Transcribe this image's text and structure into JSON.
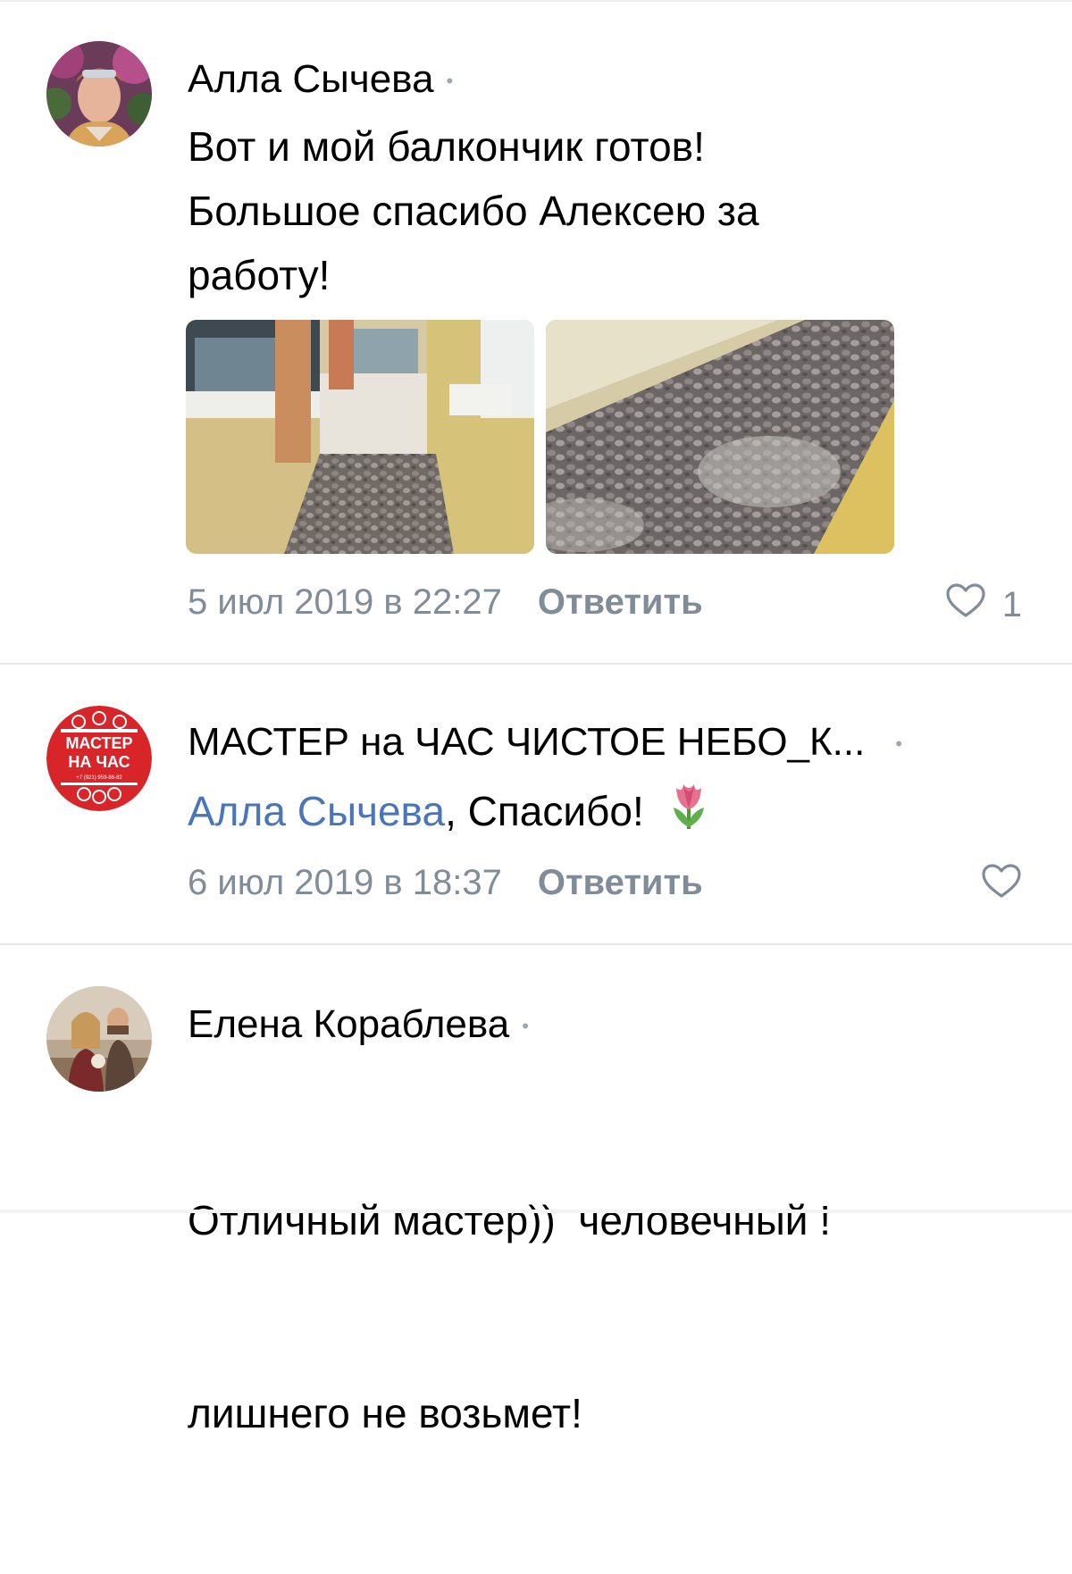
{
  "comments": [
    {
      "author": "Алла Сычева",
      "lines": [
        "Вот и мой балкончик готов!",
        "Большое спасибо Алексею за",
        "работу!"
      ],
      "date": "5 июл 2019 в 22:27",
      "reply_label": "Ответить",
      "likes": "1"
    },
    {
      "author": "МАСТЕР на ЧАС ЧИСТОЕ НЕБО_К...",
      "mention": "Алла Сычева",
      "text": ", Спасибо!",
      "date": "6 июл 2019 в 18:37",
      "reply_label": "Ответить",
      "avatar_logo": {
        "line1": "МАСТЕР",
        "line2": "НА ЧАС",
        "phone": "+7 (921) 959-86-82"
      }
    },
    {
      "author": "Елена Кораблева",
      "lines": [
        "Отличный мастер))  человечный !",
        "лишнего не возьмет!"
      ]
    }
  ],
  "colors": {
    "meta": "#818c99",
    "mention": "#4a76b8",
    "logo_red": "#d8252a"
  },
  "icons": {
    "like": "heart-outline-icon",
    "emoji": "tulip-emoji-icon",
    "separator": "dot-separator-icon"
  }
}
